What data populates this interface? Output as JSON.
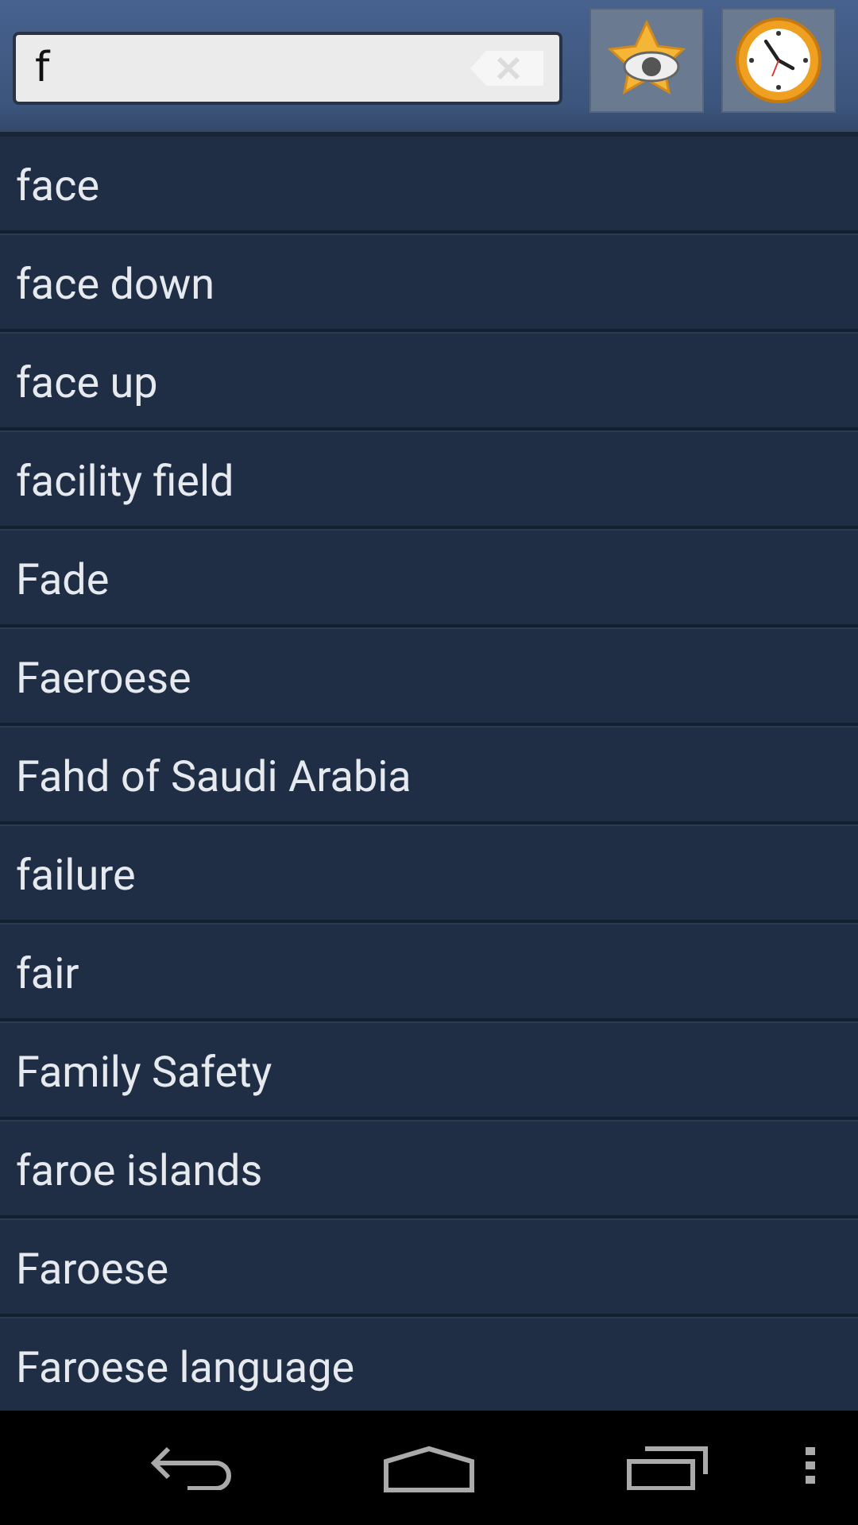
{
  "search": {
    "value": "f"
  },
  "results": [
    {
      "text": "face"
    },
    {
      "text": "face down"
    },
    {
      "text": "face up"
    },
    {
      "text": "facility field"
    },
    {
      "text": "Fade"
    },
    {
      "text": "Faeroese"
    },
    {
      "text": "Fahd of Saudi Arabia"
    },
    {
      "text": "failure"
    },
    {
      "text": "fair"
    },
    {
      "text": "Family Safety"
    },
    {
      "text": "faroe islands"
    },
    {
      "text": "Faroese"
    },
    {
      "text": "Faroese language"
    }
  ]
}
